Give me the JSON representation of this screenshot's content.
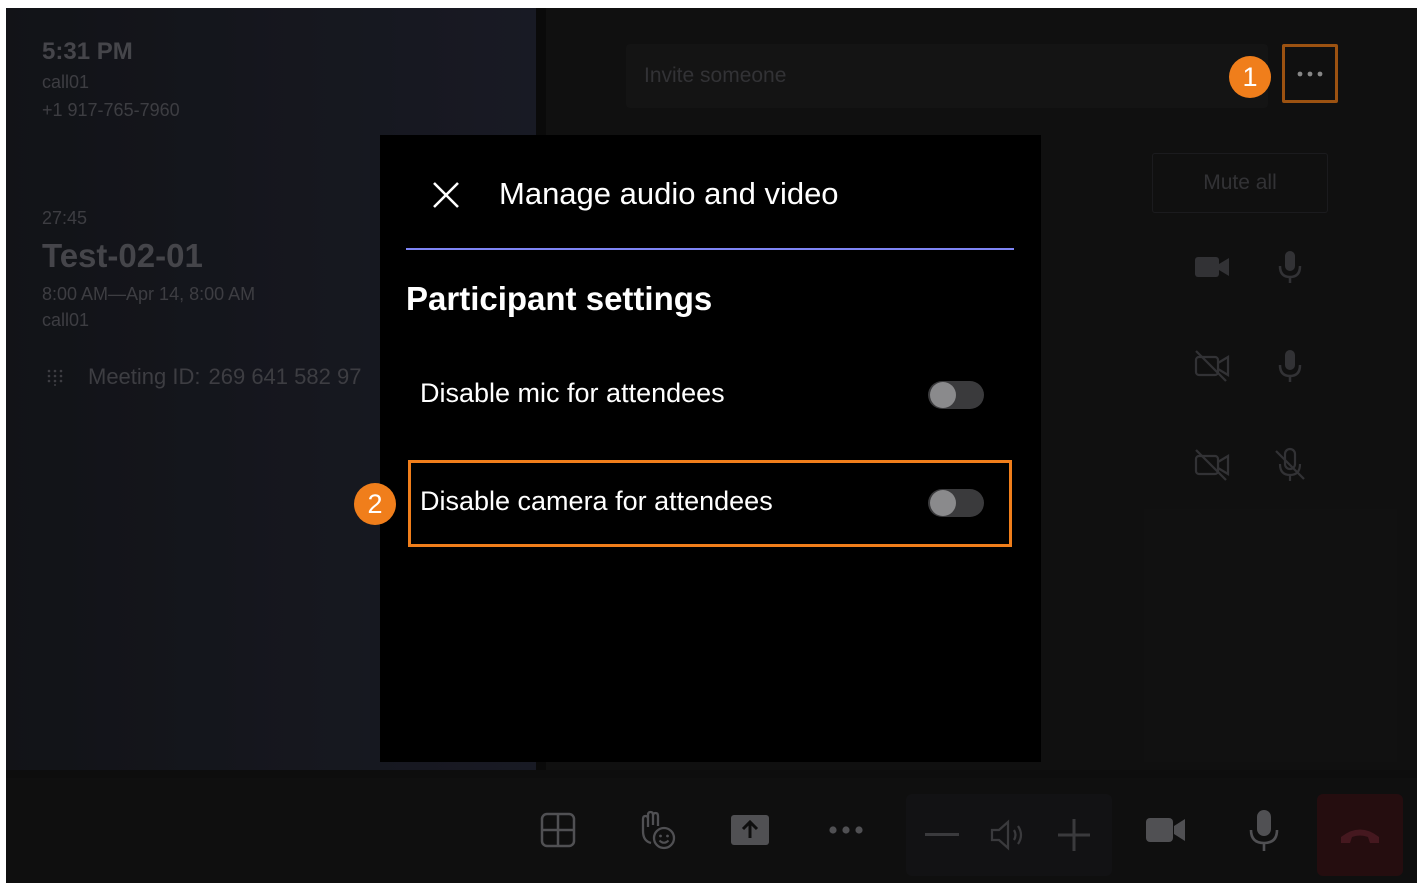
{
  "colors": {
    "accent_orange": "#f07e1b",
    "divider_purple": "#7f85f5",
    "hangup_red": "#c4314b"
  },
  "left_panel": {
    "time": "5:31 PM",
    "device_name": "call01",
    "device_phone": "+1 917-765-7960",
    "elapsed": "27:45",
    "meeting_title": "Test-02-01",
    "meeting_time": "8:00 AM—Apr 14, 8:00 AM",
    "meeting_organizer": "call01",
    "meeting_id_label": "Meeting ID:",
    "meeting_id_value": "269 641 582 97"
  },
  "right_panel": {
    "invite_placeholder": "Invite someone",
    "mute_all_label": "Mute all",
    "more_icon": "more-horizontal-icon",
    "participants": [
      {
        "camera": "video-on-icon",
        "mic": "mic-on-icon"
      },
      {
        "camera": "video-off-icon",
        "mic": "mic-on-icon"
      },
      {
        "camera": "video-off-icon",
        "mic": "mic-off-icon"
      }
    ]
  },
  "dialog": {
    "title": "Manage audio and video",
    "close_icon": "close-icon",
    "section_title": "Participant settings",
    "settings": [
      {
        "label": "Disable mic for attendees",
        "enabled": false
      },
      {
        "label": "Disable camera for attendees",
        "enabled": false
      }
    ]
  },
  "callouts": {
    "step1": "1",
    "step2": "2"
  },
  "control_bar": {
    "buttons": [
      "layout-icon",
      "raise-hand-icon",
      "share-icon",
      "more-icon",
      "volume-down-icon",
      "speaker-icon",
      "volume-up-icon",
      "camera-icon",
      "mic-icon",
      "hangup-icon"
    ]
  }
}
